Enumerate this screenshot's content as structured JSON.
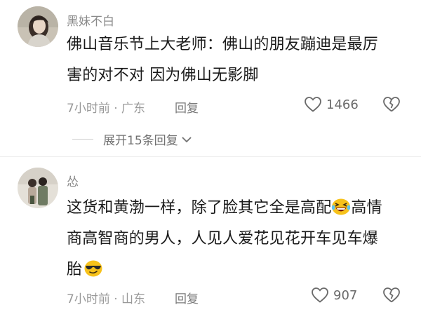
{
  "comments": [
    {
      "username": "黑妹不白",
      "lines": [
        "佛山音乐节上大老师：佛山的朋友蹦迪是最厉",
        "害的对不对 因为佛山无影脚"
      ],
      "time_location": "7小时前 · 广东",
      "reply_label": "回复",
      "likes": "1466",
      "expand_label": "展开15条回复"
    },
    {
      "username": "怂",
      "line1_a": "这货和黄渤一样，除了脸其它全是高配",
      "line1_b": "高情",
      "line2": "商高智商的男人，人见人爱花见花开车见车爆",
      "line3": "胎",
      "time_location": "7小时前 · 山东",
      "reply_label": "回复",
      "likes": "907"
    }
  ],
  "colors": {
    "username": "#8a8a8a",
    "meta": "#999999",
    "text": "#1a1a1a",
    "emoji_yellow": "#f7c21b"
  },
  "icons": [
    "heart-icon",
    "heart-broken-icon",
    "chevron-down-icon",
    "laughing-emoji",
    "sunglasses-emoji"
  ]
}
